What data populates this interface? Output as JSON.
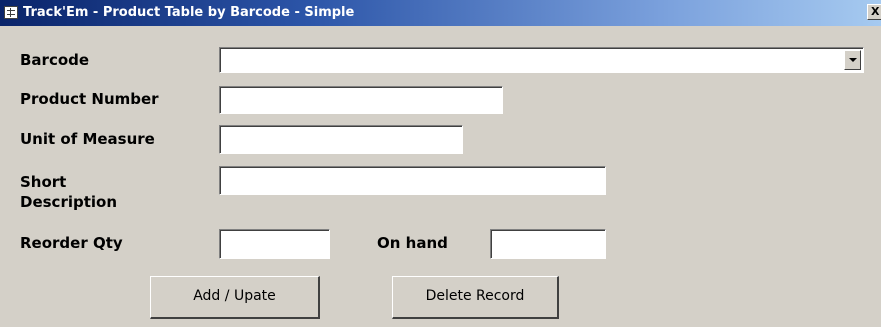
{
  "window": {
    "title": "Track'Em - Product Table by Barcode - Simple",
    "close_glyph": "X"
  },
  "form": {
    "barcode": {
      "label": "Barcode",
      "value": ""
    },
    "product_number": {
      "label": "Product Number",
      "value": ""
    },
    "unit_of_measure": {
      "label": "Unit of Measure",
      "value": ""
    },
    "short_description": {
      "label": "Short Description",
      "value": ""
    },
    "reorder_qty": {
      "label": "Reorder Qty",
      "value": ""
    },
    "on_hand": {
      "label": "On hand",
      "value": ""
    }
  },
  "buttons": {
    "add_update": "Add / Upate",
    "delete_record": "Delete Record"
  },
  "colors": {
    "face": "#d4d0c8",
    "titlebar_start": "#0a246a",
    "titlebar_end": "#a6caf0"
  },
  "icons": {
    "title": "form-icon",
    "close": "close-icon",
    "combo": "dropdown-arrow-icon"
  }
}
